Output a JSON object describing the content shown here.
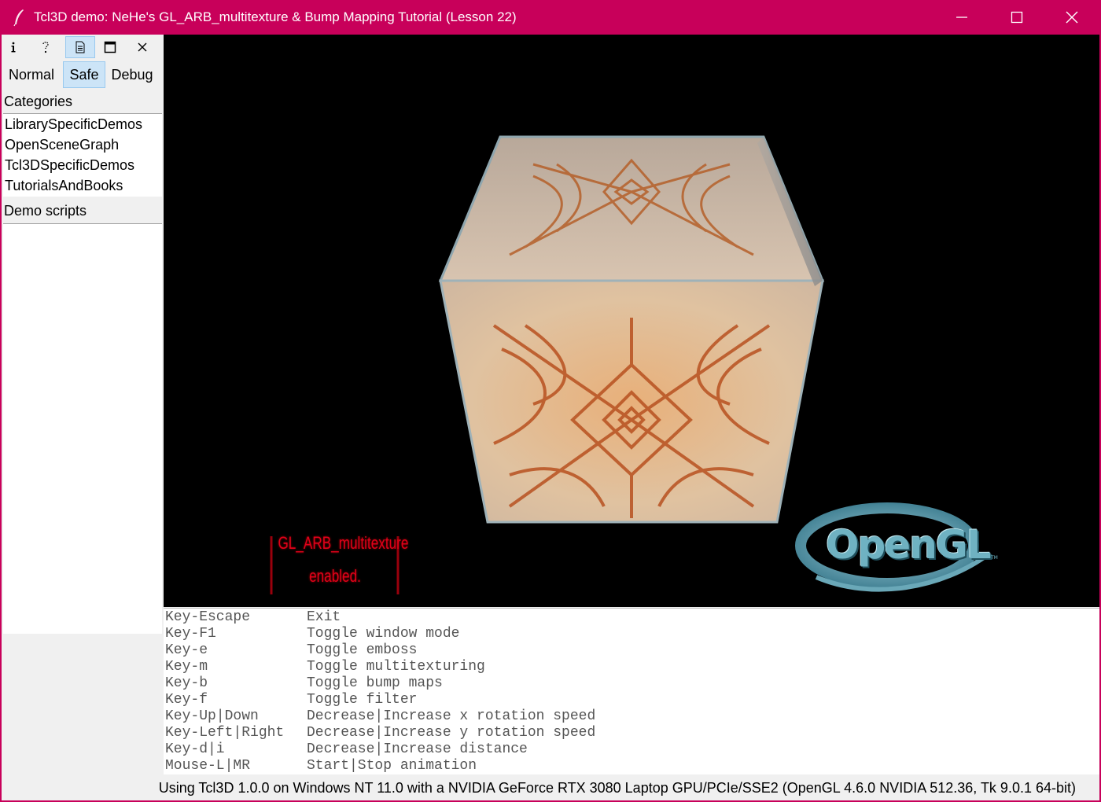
{
  "window": {
    "title": "Tcl3D demo: NeHe's GL_ARB_multitexture & Bump Mapping Tutorial (Lesson 22)",
    "controls": {
      "minimize": "minimize-icon",
      "maximize": "maximize-icon",
      "close": "close-icon"
    }
  },
  "toolbar": {
    "icons": [
      "info-icon",
      "help-icon",
      "document-icon",
      "fullscreen-icon",
      "close-icon"
    ],
    "active_icon": "document-icon",
    "modes": [
      "Normal",
      "Safe",
      "Debug"
    ],
    "active_mode": "Safe"
  },
  "categories": {
    "label": "Categories",
    "items": [
      "LibrarySpecificDemos",
      "OpenSceneGraph",
      "Tcl3DSpecificDemos",
      "TutorialsAndBooks"
    ]
  },
  "demo_scripts": {
    "label": "Demo scripts",
    "items": []
  },
  "scene": {
    "overlay_line1": "GL_ARB_multitexture",
    "overlay_line2": "enabled.",
    "logo_text": "OpenGL",
    "logo_tm": "TM",
    "colors": {
      "background": "#000000",
      "overlay": "#e0001a",
      "logo": "#5f9fb0"
    }
  },
  "help": {
    "rows": [
      {
        "key": "Key-Escape",
        "desc": "Exit"
      },
      {
        "key": "Key-F1",
        "desc": "Toggle window mode"
      },
      {
        "key": "Key-e",
        "desc": "Toggle emboss"
      },
      {
        "key": "Key-m",
        "desc": "Toggle multitexturing"
      },
      {
        "key": "Key-b",
        "desc": "Toggle bump maps"
      },
      {
        "key": "Key-f",
        "desc": "Toggle filter"
      },
      {
        "key": "Key-Up|Down",
        "desc": "Decrease|Increase x rotation speed"
      },
      {
        "key": "Key-Left|Right",
        "desc": "Decrease|Increase y rotation speed"
      },
      {
        "key": "Key-d|i",
        "desc": "Decrease|Increase distance"
      },
      {
        "key": "Mouse-L|MR",
        "desc": "Start|Stop animation"
      }
    ]
  },
  "status": {
    "text": "Using Tcl3D 1.0.0 on Windows NT 11.0 with a NVIDIA GeForce RTX 3080 Laptop GPU/PCIe/SSE2 (OpenGL 4.6.0 NVIDIA 512.36, Tk 9.0.1 64-bit)"
  }
}
